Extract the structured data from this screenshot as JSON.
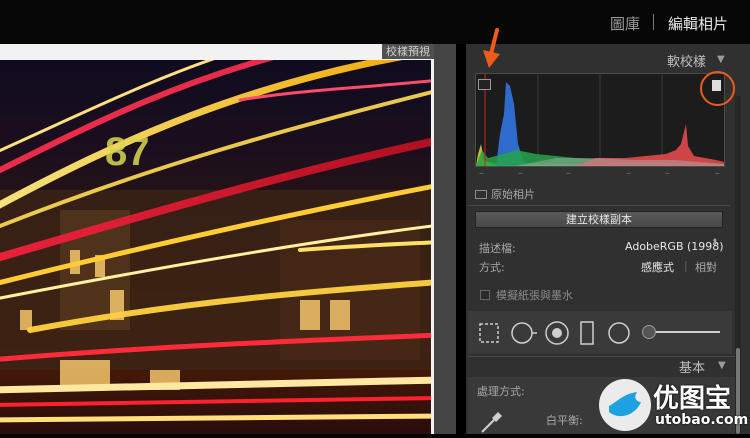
{
  "top_nav": {
    "library": "圖庫",
    "separator": "|",
    "develop": "編輯相片"
  },
  "preview": {
    "label": "校樣預視",
    "photo_number": "87"
  },
  "soft_proofing": {
    "header": "軟校樣",
    "collapse_icon": "triangle-down-icon",
    "histogram": {
      "range_marks": [
        "–",
        "–",
        "–",
        "–",
        "–",
        "–"
      ],
      "corner_left_icon": "gamut-warning-monitor-icon",
      "corner_right_icon": "gamut-warning-document-icon"
    },
    "original_photo_label": "原始相片",
    "create_copy_button": "建立校樣副本",
    "profile_label": "描述檔:",
    "profile_value": "AdobeRGB (1998)",
    "profile_dropdown_icon": "updown-caret-icon",
    "intent_label": "方式:",
    "intent_perceptual": "感應式",
    "intent_relative": "相對",
    "simulate_paper_ink": "模擬紙張與墨水"
  },
  "toolstrip": {
    "tools": [
      "crop-overlay-icon",
      "spot-removal-icon",
      "red-eye-icon",
      "graduated-filter-icon",
      "radial-filter-icon",
      "adjustment-brush-icon"
    ]
  },
  "basic": {
    "header": "基本",
    "treatment_label": "處理方式:",
    "wb_label": "白平衡:",
    "eyedropper_icon": "eyedropper-icon"
  },
  "watermark": {
    "brand": "优图宝",
    "url": "utobao.com"
  },
  "colors": {
    "accent_annotation": "#ef5b19",
    "panel_bg": "#303030"
  }
}
